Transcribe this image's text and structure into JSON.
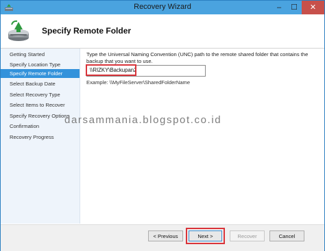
{
  "window": {
    "title": "Recovery Wizard",
    "minimize_glyph": "–",
    "maximize_glyph": "☐",
    "close_glyph": "✕"
  },
  "header": {
    "heading": "Specify Remote Folder",
    "icon": "backup-restore-icon"
  },
  "nav": {
    "items": [
      {
        "label": "Getting Started"
      },
      {
        "label": "Specify Location Type"
      },
      {
        "label": "Specify Remote Folder"
      },
      {
        "label": "Select Backup Date"
      },
      {
        "label": "Select Recovery Type"
      },
      {
        "label": "Select Items to Recover"
      },
      {
        "label": "Specify Recovery Options"
      },
      {
        "label": "Confirmation"
      },
      {
        "label": "Recovery Progress"
      }
    ],
    "active_index": 2
  },
  "main": {
    "instruction": "Type the Universal Naming Convention (UNC) path to the remote shared folder that contains the backup that you want to use.",
    "path_value": "\\\\RIZKY\\Backupan2",
    "example": "Example: \\\\MyFileServer\\SharedFolderName"
  },
  "watermark": "darsammania.blogspot.co.id",
  "buttons": {
    "previous": "< Previous",
    "next": "Next >",
    "recover": "Recover",
    "cancel": "Cancel"
  },
  "colors": {
    "titlebar": "#4aa3df",
    "active_nav": "#3392db",
    "highlight": "#d9343a",
    "close": "#c7504b"
  }
}
